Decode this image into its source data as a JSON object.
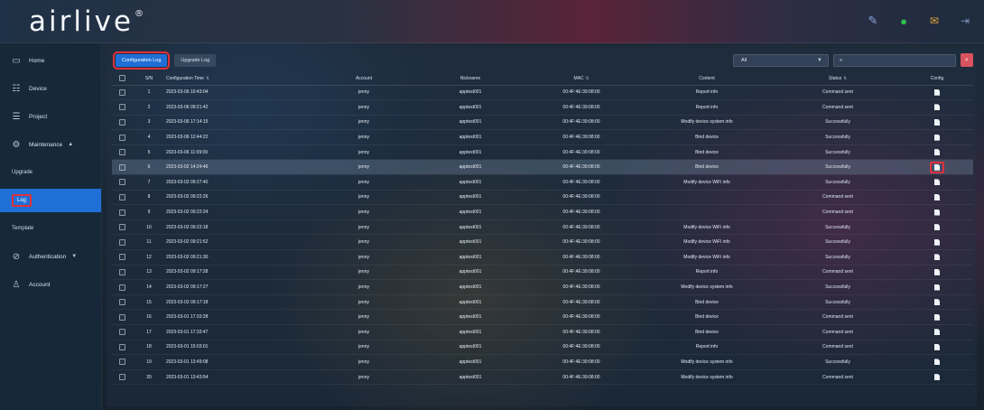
{
  "header": {
    "logo": "airlive",
    "logo_mark": "®",
    "icons": [
      "pencil-icon",
      "status-dot-icon",
      "message-icon",
      "logout-icon"
    ]
  },
  "sidebar": {
    "items": [
      {
        "label": "Home",
        "icon": "monitor-icon"
      },
      {
        "label": "Device",
        "icon": "device-icon"
      },
      {
        "label": "Project",
        "icon": "project-icon"
      },
      {
        "label": "Maintenance",
        "icon": "maintenance-icon"
      }
    ],
    "subitems": [
      {
        "label": "Upgrade"
      },
      {
        "label": "Log"
      },
      {
        "label": "Template"
      }
    ],
    "items_bottom": [
      {
        "label": "Authentication",
        "icon": "shield-icon"
      },
      {
        "label": "Account",
        "icon": "user-icon"
      }
    ]
  },
  "tabs": [
    {
      "label": "Configuration Log"
    },
    {
      "label": "Upgrade Log"
    }
  ],
  "filter": {
    "value": "All"
  },
  "search": {
    "placeholder": ""
  },
  "table": {
    "headers": [
      "S/N",
      "Configuration Time",
      "Account",
      "Nickname",
      "MAC",
      "Content",
      "Status",
      "Config"
    ],
    "rows": [
      {
        "sn": "1",
        "time": "2023-03-06 10:43:04",
        "account": "jenny",
        "nickname": "apptest001",
        "mac": "00:4F:4E:39:08:00",
        "content": "Report info",
        "status": "Command sent"
      },
      {
        "sn": "2",
        "time": "2023-03-06 09:21:42",
        "account": "jenny",
        "nickname": "apptest001",
        "mac": "00:4F:4E:39:08:00",
        "content": "Report info",
        "status": "Command sent"
      },
      {
        "sn": "3",
        "time": "2023-03-06 17:14:15",
        "account": "jenny",
        "nickname": "apptest001",
        "mac": "00:4F:4E:39:08:00",
        "content": "Modify device system info",
        "status": "Successfully"
      },
      {
        "sn": "4",
        "time": "2023-03-06 12:44:22",
        "account": "jenny",
        "nickname": "apptest001",
        "mac": "00:4F:4E:39:08:00",
        "content": "Bind device",
        "status": "Successfully"
      },
      {
        "sn": "5",
        "time": "2023-03-06 11:09:09",
        "account": "jenny",
        "nickname": "apptest001",
        "mac": "00:4F:4E:39:08:00",
        "content": "Bind device",
        "status": "Successfully"
      },
      {
        "sn": "6",
        "time": "2023-03-02 14:24:46",
        "account": "jenny",
        "nickname": "apptest001",
        "mac": "00:4F:4E:39:08:00",
        "content": "Bind device",
        "status": "Successfully"
      },
      {
        "sn": "7",
        "time": "2023-03-02 09:27:40",
        "account": "jenny",
        "nickname": "apptest001",
        "mac": "00:4F:4E:39:08:00",
        "content": "Modify device WiFi info",
        "status": "Successfully"
      },
      {
        "sn": "8",
        "time": "2023-03-02 09:22:26",
        "account": "jenny",
        "nickname": "apptest001",
        "mac": "00:4F:4E:39:08:00",
        "content": "",
        "status": "Command sent"
      },
      {
        "sn": "9",
        "time": "2023-03-02 09:22:24",
        "account": "jenny",
        "nickname": "apptest001",
        "mac": "00:4F:4E:39:08:00",
        "content": "",
        "status": "Command sent"
      },
      {
        "sn": "10",
        "time": "2023-03-02 09:22:18",
        "account": "jenny",
        "nickname": "apptest001",
        "mac": "00:4F:4E:39:08:00",
        "content": "Modify device WiFi info",
        "status": "Successfully"
      },
      {
        "sn": "11",
        "time": "2023-03-02 09:21:52",
        "account": "jenny",
        "nickname": "apptest001",
        "mac": "00:4F:4E:39:08:00",
        "content": "Modify device WiFi info",
        "status": "Successfully"
      },
      {
        "sn": "12",
        "time": "2023-03-02 09:21:30",
        "account": "jenny",
        "nickname": "apptest001",
        "mac": "00:4F:4E:39:08:00",
        "content": "Modify device WiFi info",
        "status": "Successfully"
      },
      {
        "sn": "13",
        "time": "2023-03-02 09:17:28",
        "account": "jenny",
        "nickname": "apptest001",
        "mac": "00:4F:4E:39:08:00",
        "content": "Report info",
        "status": "Command sent"
      },
      {
        "sn": "14",
        "time": "2023-03-02 09:17:27",
        "account": "jenny",
        "nickname": "apptest001",
        "mac": "00:4F:4E:39:08:00",
        "content": "Modify device system info",
        "status": "Successfully"
      },
      {
        "sn": "15",
        "time": "2023-03-02 09:17:18",
        "account": "jenny",
        "nickname": "apptest001",
        "mac": "00:4F:4E:39:08:00",
        "content": "Bind device",
        "status": "Successfully"
      },
      {
        "sn": "16",
        "time": "2023-03-01 17:33:28",
        "account": "jenny",
        "nickname": "apptest001",
        "mac": "00:4F:4E:39:08:00",
        "content": "Bind device",
        "status": "Command sent"
      },
      {
        "sn": "17",
        "time": "2023-03-01 17:33:47",
        "account": "jenny",
        "nickname": "apptest001",
        "mac": "00:4F:4E:39:08:00",
        "content": "Bind device",
        "status": "Command sent"
      },
      {
        "sn": "18",
        "time": "2023-03-01 15:03:01",
        "account": "jenny",
        "nickname": "apptest001",
        "mac": "00:4F:4E:39:08:00",
        "content": "Report info",
        "status": "Command sent"
      },
      {
        "sn": "19",
        "time": "2023-03-01 13:49:08",
        "account": "jenny",
        "nickname": "apptest001",
        "mac": "00:4F:4E:39:08:00",
        "content": "Modify device system info",
        "status": "Successfully"
      },
      {
        "sn": "20",
        "time": "2023-03-01 13:43:54",
        "account": "jenny",
        "nickname": "apptest001",
        "mac": "00:4F:4E:39:08:00",
        "content": "Modify device system info",
        "status": "Command sent"
      }
    ]
  }
}
